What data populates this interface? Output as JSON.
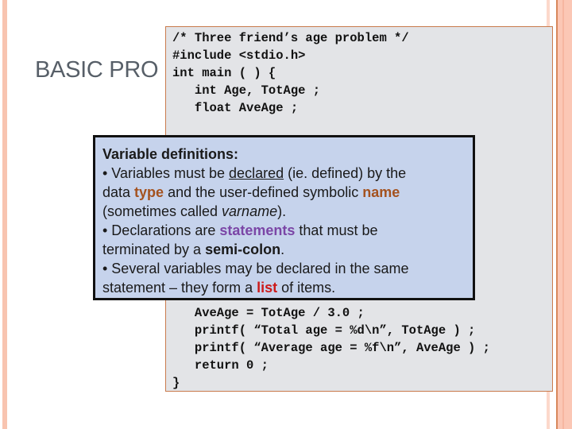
{
  "slide": {
    "title": "BASIC PRO",
    "colors": {
      "accent_stripe": "#f8c4b0",
      "code_border": "#c97b4d",
      "code_background": "#e3e4e7",
      "callout_background": "#c6d3ec",
      "keyword_type_name": "#a4521f",
      "keyword_statements": "#7b46a6",
      "keyword_list": "#cc1a1a"
    }
  },
  "code": {
    "lines_top": [
      "/* Three friend’s age problem */",
      "#include <stdio.h>",
      "int main ( ) {",
      "   int Age, TotAge ;",
      "   float AveAge ;"
    ],
    "lines_bottom": [
      "   AveAge = TotAge / 3.0 ;",
      "   printf( “Total age = %d\\n”, TotAge ) ;",
      "   printf( “Average age = %f\\n”, AveAge ) ;",
      "   return 0 ;",
      "}"
    ]
  },
  "callout": {
    "heading": "Variable definitions:",
    "bullet1": {
      "prefix": "• Variables must be ",
      "underlined": "declared",
      "suffix": " (ie. defined) by the",
      "line2_pre": "data ",
      "type_word": "type",
      "line2_mid": " and the user-defined symbolic ",
      "name_word": "name",
      "line3_pre": "(sometimes called ",
      "italic_word": "varname",
      "line3_post": ")."
    },
    "bullet2": {
      "prefix": "• Declarations are ",
      "statements_word": "statements",
      "suffix": " that must be",
      "line2_pre": "terminated by a ",
      "bold_word": "semi-colon",
      "line2_post": "."
    },
    "bullet3": {
      "line1": "• Several variables may be declared in the same",
      "line2_pre": "statement – they form a ",
      "list_word": "list",
      "line2_post": " of items."
    }
  }
}
